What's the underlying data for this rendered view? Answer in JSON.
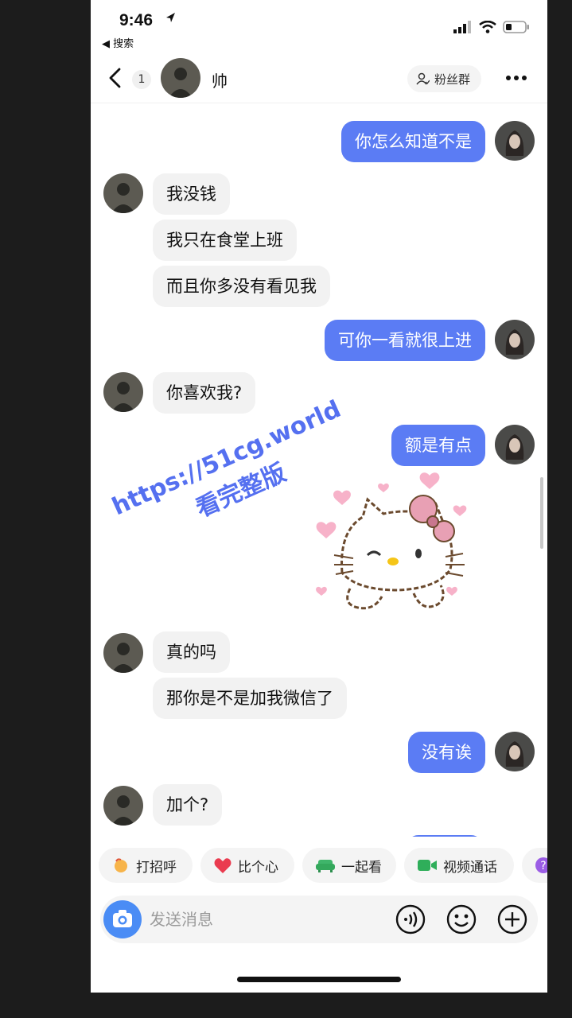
{
  "status_bar": {
    "time": "9:46",
    "back_app": "◀ 搜索"
  },
  "header": {
    "unread_count": "1",
    "contact_name": "帅",
    "fan_group_label": "粉丝群"
  },
  "messages": [
    {
      "side": "out",
      "text": "你怎么知道不是"
    },
    {
      "side": "in",
      "text": "我没钱"
    },
    {
      "side": "in",
      "text": "我只在食堂上班"
    },
    {
      "side": "in",
      "text": "而且你多没有看见我"
    },
    {
      "side": "out",
      "text": "可你一看就很上进"
    },
    {
      "side": "in",
      "text": "你喜欢我?"
    },
    {
      "side": "out",
      "text": "额是有点"
    },
    {
      "side": "in",
      "text": "真的吗"
    },
    {
      "side": "in",
      "text": "那你是不是加我微信了"
    },
    {
      "side": "out",
      "text": "没有诶"
    },
    {
      "side": "in",
      "text": "加个?"
    }
  ],
  "watermark": {
    "url": "https://51cg.world",
    "subtitle": "看完整版"
  },
  "quick_actions": [
    {
      "label": "打招呼",
      "icon": "wave-hand-icon"
    },
    {
      "label": "比个心",
      "icon": "heart-icon"
    },
    {
      "label": "一起看",
      "icon": "sofa-icon"
    },
    {
      "label": "视频通话",
      "icon": "video-call-icon"
    }
  ],
  "input": {
    "placeholder": "发送消息"
  },
  "colors": {
    "outgoing_bubble": "#5b7cf4",
    "incoming_bubble": "#f2f2f2",
    "camera_button": "#4a8cf5"
  }
}
